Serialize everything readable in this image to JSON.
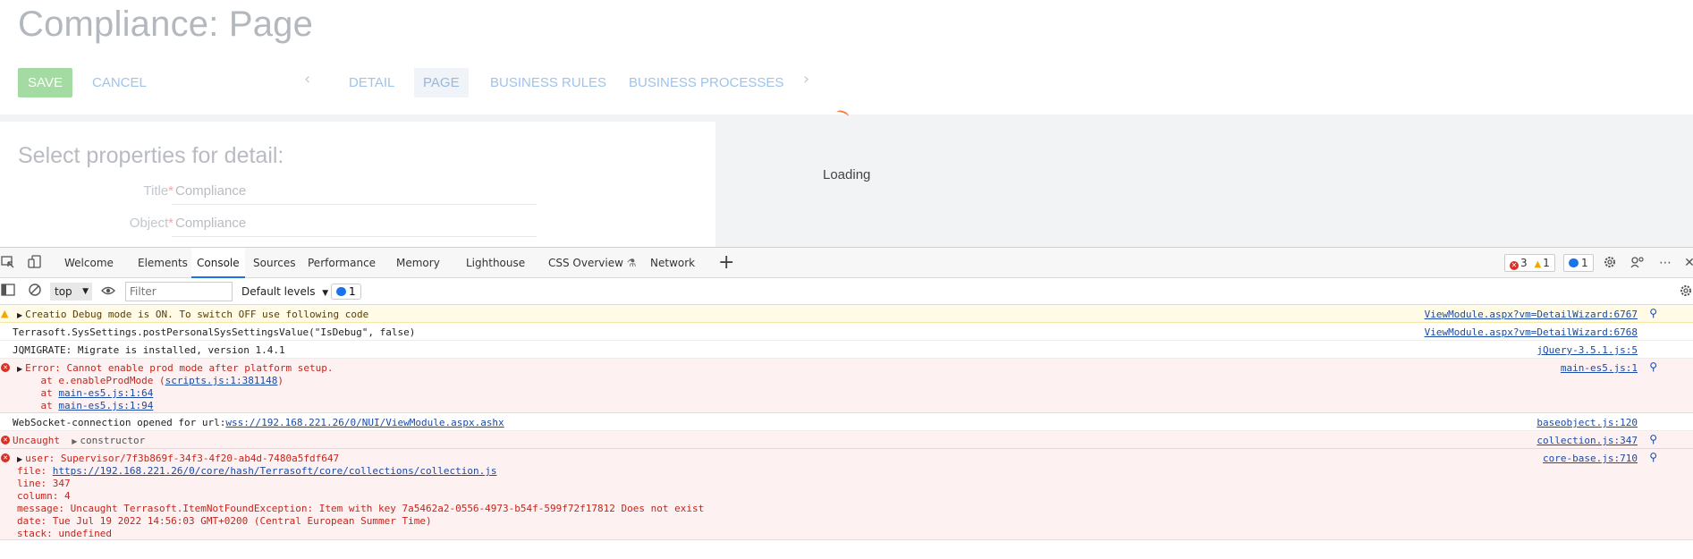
{
  "app": {
    "title": "Compliance: Page",
    "save_label": "SAVE",
    "cancel_label": "CANCEL",
    "tabs": [
      {
        "label": "DETAIL"
      },
      {
        "label": "PAGE"
      },
      {
        "label": "BUSINESS RULES"
      },
      {
        "label": "BUSINESS PROCESSES"
      }
    ],
    "props_title": "Select properties for detail:",
    "fields": [
      {
        "label": "Title",
        "required": "*",
        "value": "Compliance"
      },
      {
        "label": "Object",
        "required": "*",
        "value": "Compliance"
      }
    ],
    "loading": "Loading"
  },
  "devtools": {
    "tabs": [
      {
        "label": "Welcome"
      },
      {
        "label": "Elements"
      },
      {
        "label": "Console"
      },
      {
        "label": "Sources"
      },
      {
        "label": "Performance"
      },
      {
        "label": "Memory"
      },
      {
        "label": "Lighthouse"
      },
      {
        "label": "CSS Overview"
      },
      {
        "label": "Network"
      }
    ],
    "counts": {
      "errors": "3",
      "warnings": "1",
      "info": "1"
    },
    "context": "top",
    "filter_placeholder": "Filter",
    "levels": "Default levels",
    "issues": "1",
    "messages": {
      "m1": {
        "text": "Creatio Debug mode is ON. To switch OFF use following code",
        "src": "ViewModule.aspx?vm=DetailWizard:6767"
      },
      "m2": {
        "text": "Terrasoft.SysSettings.postPersonalSysSettingsValue(\"IsDebug\", false)",
        "src": "ViewModule.aspx?vm=DetailWizard:6768"
      },
      "m3": {
        "text": "JQMIGRATE: Migrate is installed, version 1.4.1",
        "src": "jQuery-3.5.1.js:5"
      },
      "m4": {
        "text": "Error: Cannot enable prod mode after platform setup.",
        "l2_pre": "    at e.enableProdMode (",
        "l2_link": "scripts.js:1:381148",
        "l2_post": ")",
        "l3_pre": "    at ",
        "l3_link": "main-es5.js:1:64",
        "l4_pre": "    at ",
        "l4_link": "main-es5.js:1:94",
        "src": "main-es5.js:1"
      },
      "m5": {
        "pre": "WebSocket-connection opened for url:",
        "link": "wss://192.168.221.26/0/NUI/ViewModule.aspx.ashx",
        "src": "baseobject.js:120"
      },
      "m6": {
        "text": "Uncaught",
        "obj": "constructor",
        "src": "collection.js:347"
      },
      "m7": {
        "l1": "user: Supervisor/7f3b869f-34f3-4f20-ab4d-7480a5fdf647",
        "file_pre": "file: ",
        "file_link": "https://192.168.221.26/0/core/hash/Terrasoft/core/collections/collection.js",
        "l3": "line: 347",
        "l4": "column: 4",
        "l5": "message: Uncaught Terrasoft.ItemNotFoundException: Item with key 7a5462a2-0556-4973-b54f-599f72f17812 Does not exist",
        "l6": "date: Tue Jul 19 2022 14:56:03 GMT+0200 (Central European Summer Time)",
        "l7": "stack: undefined",
        "src": "core-base.js:710"
      }
    }
  }
}
